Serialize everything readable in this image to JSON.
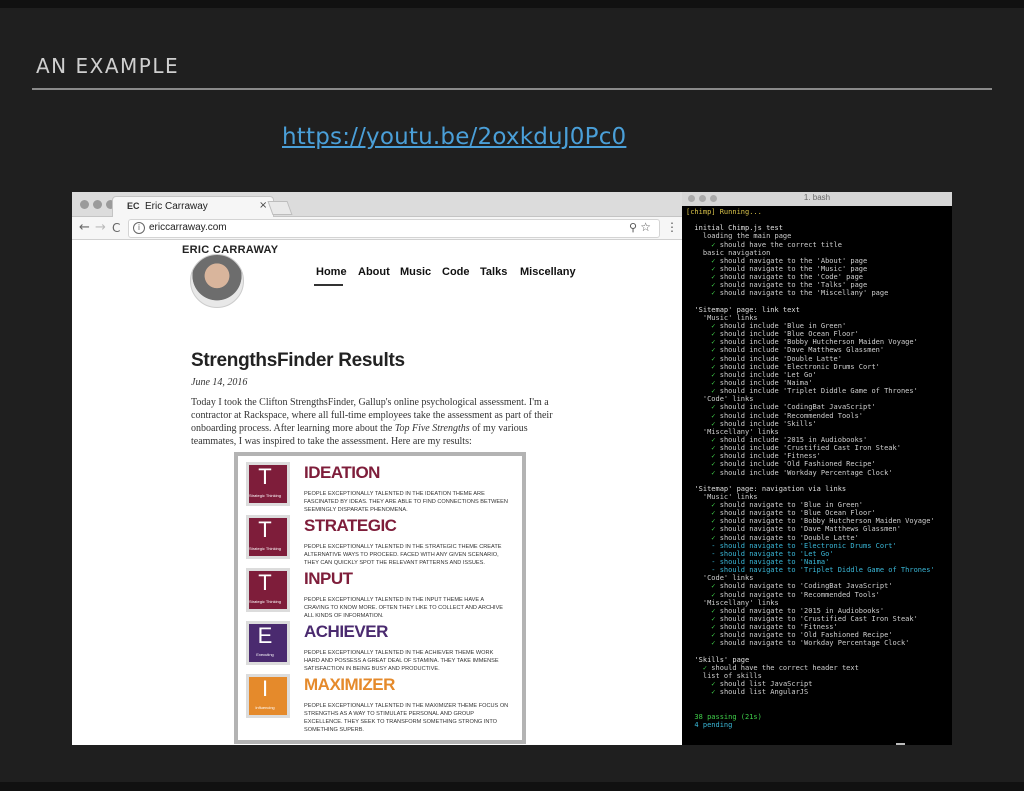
{
  "slide": {
    "title": "AN EXAMPLE",
    "link": "https://youtu.be/2oxkduJ0Pc0"
  },
  "browser": {
    "tab_logo": "EC",
    "tab_title": "Eric Carraway",
    "tab_close": "×",
    "url": "ericcarraway.com",
    "back_glyph": "←",
    "forward_glyph": "→",
    "reload_glyph": "C",
    "site_name": "ERIC CARRAWAY",
    "nav": [
      "Home",
      "About",
      "Music",
      "Code",
      "Talks",
      "Miscellany"
    ],
    "post": {
      "title": "StrengthsFinder Results",
      "date": "June 14, 2016",
      "body_1": "Today I took the Clifton StrengthsFinder, Gallup's online psychological assessment. I'm a contractor at Rackspace, where all full-time employees take the assessment as part of their onboarding process. After learning more about the ",
      "body_italic": "Top Five Strengths",
      "body_2": " of my various teammates, I was inspired to take the assessment. Here are my results:"
    },
    "strengths": [
      {
        "letter": "T",
        "category": "Strategic Thinking",
        "name": "IDEATION",
        "color": "#7e1d3a",
        "desc": "People exceptionally talented in the Ideation theme are fascinated by ideas. They are able to find connections between seemingly disparate phenomena."
      },
      {
        "letter": "T",
        "category": "Strategic Thinking",
        "name": "STRATEGIC",
        "color": "#7e1d3a",
        "desc": "People exceptionally talented in the Strategic theme create alternative ways to proceed. Faced with any given scenario, they can quickly spot the relevant patterns and issues."
      },
      {
        "letter": "T",
        "category": "Strategic Thinking",
        "name": "INPUT",
        "color": "#7e1d3a",
        "desc": "People exceptionally talented in the Input theme have a craving to know more. Often they like to collect and archive all kinds of information."
      },
      {
        "letter": "E",
        "category": "Executing",
        "name": "ACHIEVER",
        "color": "#4a2a6f",
        "desc": "People exceptionally talented in the Achiever theme work hard and possess a great deal of stamina. They take immense satisfaction in being busy and productive."
      },
      {
        "letter": "I",
        "category": "Influencing",
        "name": "MAXIMIZER",
        "color": "#e58a2b",
        "desc": "People exceptionally talented in the Maximizer theme focus on strengths as a way to stimulate personal and group excellence. They seek to transform something strong into something superb."
      }
    ]
  },
  "terminal": {
    "title": "1. bash",
    "lines": [
      {
        "t": "[chimp] Running...",
        "c": "c-yellow"
      },
      {
        "t": "",
        "c": "c-text"
      },
      {
        "t": "  initial Chimp.js test",
        "c": "c-head"
      },
      {
        "t": "    loading the main page",
        "c": "c-text"
      },
      {
        "t": "      ✓ should have the correct title",
        "c": "c-pass"
      },
      {
        "t": "    basic navigation",
        "c": "c-text"
      },
      {
        "t": "      ✓ should navigate to the 'About' page",
        "c": "c-pass"
      },
      {
        "t": "      ✓ should navigate to the 'Music' page",
        "c": "c-pass"
      },
      {
        "t": "      ✓ should navigate to the 'Code' page",
        "c": "c-pass"
      },
      {
        "t": "      ✓ should navigate to the 'Talks' page",
        "c": "c-pass"
      },
      {
        "t": "      ✓ should navigate to the 'Miscellany' page",
        "c": "c-pass"
      },
      {
        "t": "",
        "c": "c-text"
      },
      {
        "t": "  'Sitemap' page: link text",
        "c": "c-head"
      },
      {
        "t": "    'Music' links",
        "c": "c-text"
      },
      {
        "t": "      ✓ should include 'Blue in Green'",
        "c": "c-pass"
      },
      {
        "t": "      ✓ should include 'Blue Ocean Floor'",
        "c": "c-pass"
      },
      {
        "t": "      ✓ should include 'Bobby Hutcherson Maiden Voyage'",
        "c": "c-pass"
      },
      {
        "t": "      ✓ should include 'Dave Matthews Glassmen'",
        "c": "c-pass"
      },
      {
        "t": "      ✓ should include 'Double Latte'",
        "c": "c-pass"
      },
      {
        "t": "      ✓ should include 'Electronic Drums Cort'",
        "c": "c-pass"
      },
      {
        "t": "      ✓ should include 'Let Go'",
        "c": "c-pass"
      },
      {
        "t": "      ✓ should include 'Naima'",
        "c": "c-pass"
      },
      {
        "t": "      ✓ should include 'Triplet Diddle Game of Thrones'",
        "c": "c-pass"
      },
      {
        "t": "    'Code' links",
        "c": "c-text"
      },
      {
        "t": "      ✓ should include 'CodingBat JavaScript'",
        "c": "c-pass"
      },
      {
        "t": "      ✓ should include 'Recommended Tools'",
        "c": "c-pass"
      },
      {
        "t": "      ✓ should include 'Skills'",
        "c": "c-pass"
      },
      {
        "t": "    'Miscellany' links",
        "c": "c-text"
      },
      {
        "t": "      ✓ should include '2015 in Audiobooks'",
        "c": "c-pass"
      },
      {
        "t": "      ✓ should include 'Crustified Cast Iron Steak'",
        "c": "c-pass"
      },
      {
        "t": "      ✓ should include 'Fitness'",
        "c": "c-pass"
      },
      {
        "t": "      ✓ should include 'Old Fashioned Recipe'",
        "c": "c-pass"
      },
      {
        "t": "      ✓ should include 'Workday Percentage Clock'",
        "c": "c-pass"
      },
      {
        "t": "",
        "c": "c-text"
      },
      {
        "t": "  'Sitemap' page: navigation via links",
        "c": "c-head"
      },
      {
        "t": "    'Music' links",
        "c": "c-text"
      },
      {
        "t": "      ✓ should navigate to 'Blue in Green'",
        "c": "c-pass"
      },
      {
        "t": "      ✓ should navigate to 'Blue Ocean Floor'",
        "c": "c-pass"
      },
      {
        "t": "      ✓ should navigate to 'Bobby Hutcherson Maiden Voyage'",
        "c": "c-pass"
      },
      {
        "t": "      ✓ should navigate to 'Dave Matthews Glassmen'",
        "c": "c-pass"
      },
      {
        "t": "      ✓ should navigate to 'Double Latte'",
        "c": "c-pass"
      },
      {
        "t": "      - should navigate to 'Electronic Drums Cort'",
        "c": "c-pend"
      },
      {
        "t": "      - should navigate to 'Let Go'",
        "c": "c-pend"
      },
      {
        "t": "      - should navigate to 'Naima'",
        "c": "c-pend"
      },
      {
        "t": "      - should navigate to 'Triplet Diddle Game of Thrones'",
        "c": "c-pend"
      },
      {
        "t": "    'Code' links",
        "c": "c-text"
      },
      {
        "t": "      ✓ should navigate to 'CodingBat JavaScript'",
        "c": "c-pass"
      },
      {
        "t": "      ✓ should navigate to 'Recommended Tools'",
        "c": "c-pass"
      },
      {
        "t": "    'Miscellany' links",
        "c": "c-text"
      },
      {
        "t": "      ✓ should navigate to '2015 in Audiobooks'",
        "c": "c-pass"
      },
      {
        "t": "      ✓ should navigate to 'Crustified Cast Iron Steak'",
        "c": "c-pass"
      },
      {
        "t": "      ✓ should navigate to 'Fitness'",
        "c": "c-pass"
      },
      {
        "t": "      ✓ should navigate to 'Old Fashioned Recipe'",
        "c": "c-pass"
      },
      {
        "t": "      ✓ should navigate to 'Workday Percentage Clock'",
        "c": "c-pass"
      },
      {
        "t": "",
        "c": "c-text"
      },
      {
        "t": "  'Skills' page",
        "c": "c-head"
      },
      {
        "t": "    ✓ should have the correct header text",
        "c": "c-pass"
      },
      {
        "t": "    list of skills",
        "c": "c-text"
      },
      {
        "t": "      ✓ should list JavaScript",
        "c": "c-pass"
      },
      {
        "t": "      ✓ should list AngularJS",
        "c": "c-pass"
      },
      {
        "t": "",
        "c": "c-text"
      },
      {
        "t": "",
        "c": "c-text"
      },
      {
        "t": "  38 passing (21s)",
        "c": "c-green"
      },
      {
        "t": "  4 pending",
        "c": "c-cyan"
      }
    ]
  }
}
